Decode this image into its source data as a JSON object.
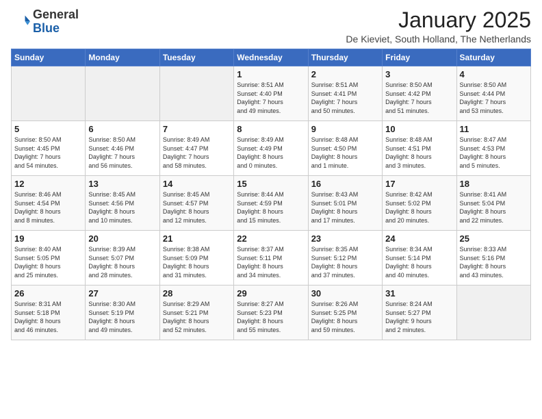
{
  "logo": {
    "general": "General",
    "blue": "Blue"
  },
  "header": {
    "title": "January 2025",
    "subtitle": "De Kieviet, South Holland, The Netherlands"
  },
  "weekdays": [
    "Sunday",
    "Monday",
    "Tuesday",
    "Wednesday",
    "Thursday",
    "Friday",
    "Saturday"
  ],
  "weeks": [
    [
      {
        "day": "",
        "info": ""
      },
      {
        "day": "",
        "info": ""
      },
      {
        "day": "",
        "info": ""
      },
      {
        "day": "1",
        "info": "Sunrise: 8:51 AM\nSunset: 4:40 PM\nDaylight: 7 hours\nand 49 minutes."
      },
      {
        "day": "2",
        "info": "Sunrise: 8:51 AM\nSunset: 4:41 PM\nDaylight: 7 hours\nand 50 minutes."
      },
      {
        "day": "3",
        "info": "Sunrise: 8:50 AM\nSunset: 4:42 PM\nDaylight: 7 hours\nand 51 minutes."
      },
      {
        "day": "4",
        "info": "Sunrise: 8:50 AM\nSunset: 4:44 PM\nDaylight: 7 hours\nand 53 minutes."
      }
    ],
    [
      {
        "day": "5",
        "info": "Sunrise: 8:50 AM\nSunset: 4:45 PM\nDaylight: 7 hours\nand 54 minutes."
      },
      {
        "day": "6",
        "info": "Sunrise: 8:50 AM\nSunset: 4:46 PM\nDaylight: 7 hours\nand 56 minutes."
      },
      {
        "day": "7",
        "info": "Sunrise: 8:49 AM\nSunset: 4:47 PM\nDaylight: 7 hours\nand 58 minutes."
      },
      {
        "day": "8",
        "info": "Sunrise: 8:49 AM\nSunset: 4:49 PM\nDaylight: 8 hours\nand 0 minutes."
      },
      {
        "day": "9",
        "info": "Sunrise: 8:48 AM\nSunset: 4:50 PM\nDaylight: 8 hours\nand 1 minute."
      },
      {
        "day": "10",
        "info": "Sunrise: 8:48 AM\nSunset: 4:51 PM\nDaylight: 8 hours\nand 3 minutes."
      },
      {
        "day": "11",
        "info": "Sunrise: 8:47 AM\nSunset: 4:53 PM\nDaylight: 8 hours\nand 5 minutes."
      }
    ],
    [
      {
        "day": "12",
        "info": "Sunrise: 8:46 AM\nSunset: 4:54 PM\nDaylight: 8 hours\nand 8 minutes."
      },
      {
        "day": "13",
        "info": "Sunrise: 8:45 AM\nSunset: 4:56 PM\nDaylight: 8 hours\nand 10 minutes."
      },
      {
        "day": "14",
        "info": "Sunrise: 8:45 AM\nSunset: 4:57 PM\nDaylight: 8 hours\nand 12 minutes."
      },
      {
        "day": "15",
        "info": "Sunrise: 8:44 AM\nSunset: 4:59 PM\nDaylight: 8 hours\nand 15 minutes."
      },
      {
        "day": "16",
        "info": "Sunrise: 8:43 AM\nSunset: 5:01 PM\nDaylight: 8 hours\nand 17 minutes."
      },
      {
        "day": "17",
        "info": "Sunrise: 8:42 AM\nSunset: 5:02 PM\nDaylight: 8 hours\nand 20 minutes."
      },
      {
        "day": "18",
        "info": "Sunrise: 8:41 AM\nSunset: 5:04 PM\nDaylight: 8 hours\nand 22 minutes."
      }
    ],
    [
      {
        "day": "19",
        "info": "Sunrise: 8:40 AM\nSunset: 5:05 PM\nDaylight: 8 hours\nand 25 minutes."
      },
      {
        "day": "20",
        "info": "Sunrise: 8:39 AM\nSunset: 5:07 PM\nDaylight: 8 hours\nand 28 minutes."
      },
      {
        "day": "21",
        "info": "Sunrise: 8:38 AM\nSunset: 5:09 PM\nDaylight: 8 hours\nand 31 minutes."
      },
      {
        "day": "22",
        "info": "Sunrise: 8:37 AM\nSunset: 5:11 PM\nDaylight: 8 hours\nand 34 minutes."
      },
      {
        "day": "23",
        "info": "Sunrise: 8:35 AM\nSunset: 5:12 PM\nDaylight: 8 hours\nand 37 minutes."
      },
      {
        "day": "24",
        "info": "Sunrise: 8:34 AM\nSunset: 5:14 PM\nDaylight: 8 hours\nand 40 minutes."
      },
      {
        "day": "25",
        "info": "Sunrise: 8:33 AM\nSunset: 5:16 PM\nDaylight: 8 hours\nand 43 minutes."
      }
    ],
    [
      {
        "day": "26",
        "info": "Sunrise: 8:31 AM\nSunset: 5:18 PM\nDaylight: 8 hours\nand 46 minutes."
      },
      {
        "day": "27",
        "info": "Sunrise: 8:30 AM\nSunset: 5:19 PM\nDaylight: 8 hours\nand 49 minutes."
      },
      {
        "day": "28",
        "info": "Sunrise: 8:29 AM\nSunset: 5:21 PM\nDaylight: 8 hours\nand 52 minutes."
      },
      {
        "day": "29",
        "info": "Sunrise: 8:27 AM\nSunset: 5:23 PM\nDaylight: 8 hours\nand 55 minutes."
      },
      {
        "day": "30",
        "info": "Sunrise: 8:26 AM\nSunset: 5:25 PM\nDaylight: 8 hours\nand 59 minutes."
      },
      {
        "day": "31",
        "info": "Sunrise: 8:24 AM\nSunset: 5:27 PM\nDaylight: 9 hours\nand 2 minutes."
      },
      {
        "day": "",
        "info": ""
      }
    ]
  ]
}
